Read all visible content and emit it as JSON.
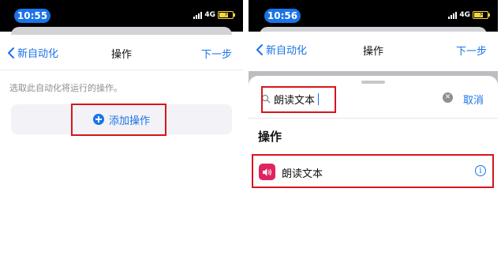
{
  "left_screen": {
    "status": {
      "time": "10:55",
      "network": "4G"
    },
    "nav": {
      "back_label": "新自动化",
      "title": "操作",
      "next_label": "下一步"
    },
    "hint": "选取此自动化将运行的操作。",
    "add_action_label": "添加操作",
    "icons": {
      "back": "chevron-left-icon",
      "add": "plus-circle-icon"
    }
  },
  "right_screen": {
    "status": {
      "time": "10:56",
      "network": "4G"
    },
    "nav": {
      "back_label": "新自动化",
      "title": "操作",
      "next_label": "下一步"
    },
    "search": {
      "value": "朗读文本",
      "cancel_label": "取消"
    },
    "section_title": "操作",
    "result": {
      "label": "朗读文本"
    },
    "icons": {
      "search": "magnifier-icon",
      "clear": "clear-icon",
      "speaker": "speaker-icon",
      "info": "info-icon"
    }
  },
  "colors": {
    "accent": "#1a73e8",
    "highlight": "#d6161c",
    "speaker_bg": "#e0245e",
    "time_pill": "#1a73e8"
  }
}
